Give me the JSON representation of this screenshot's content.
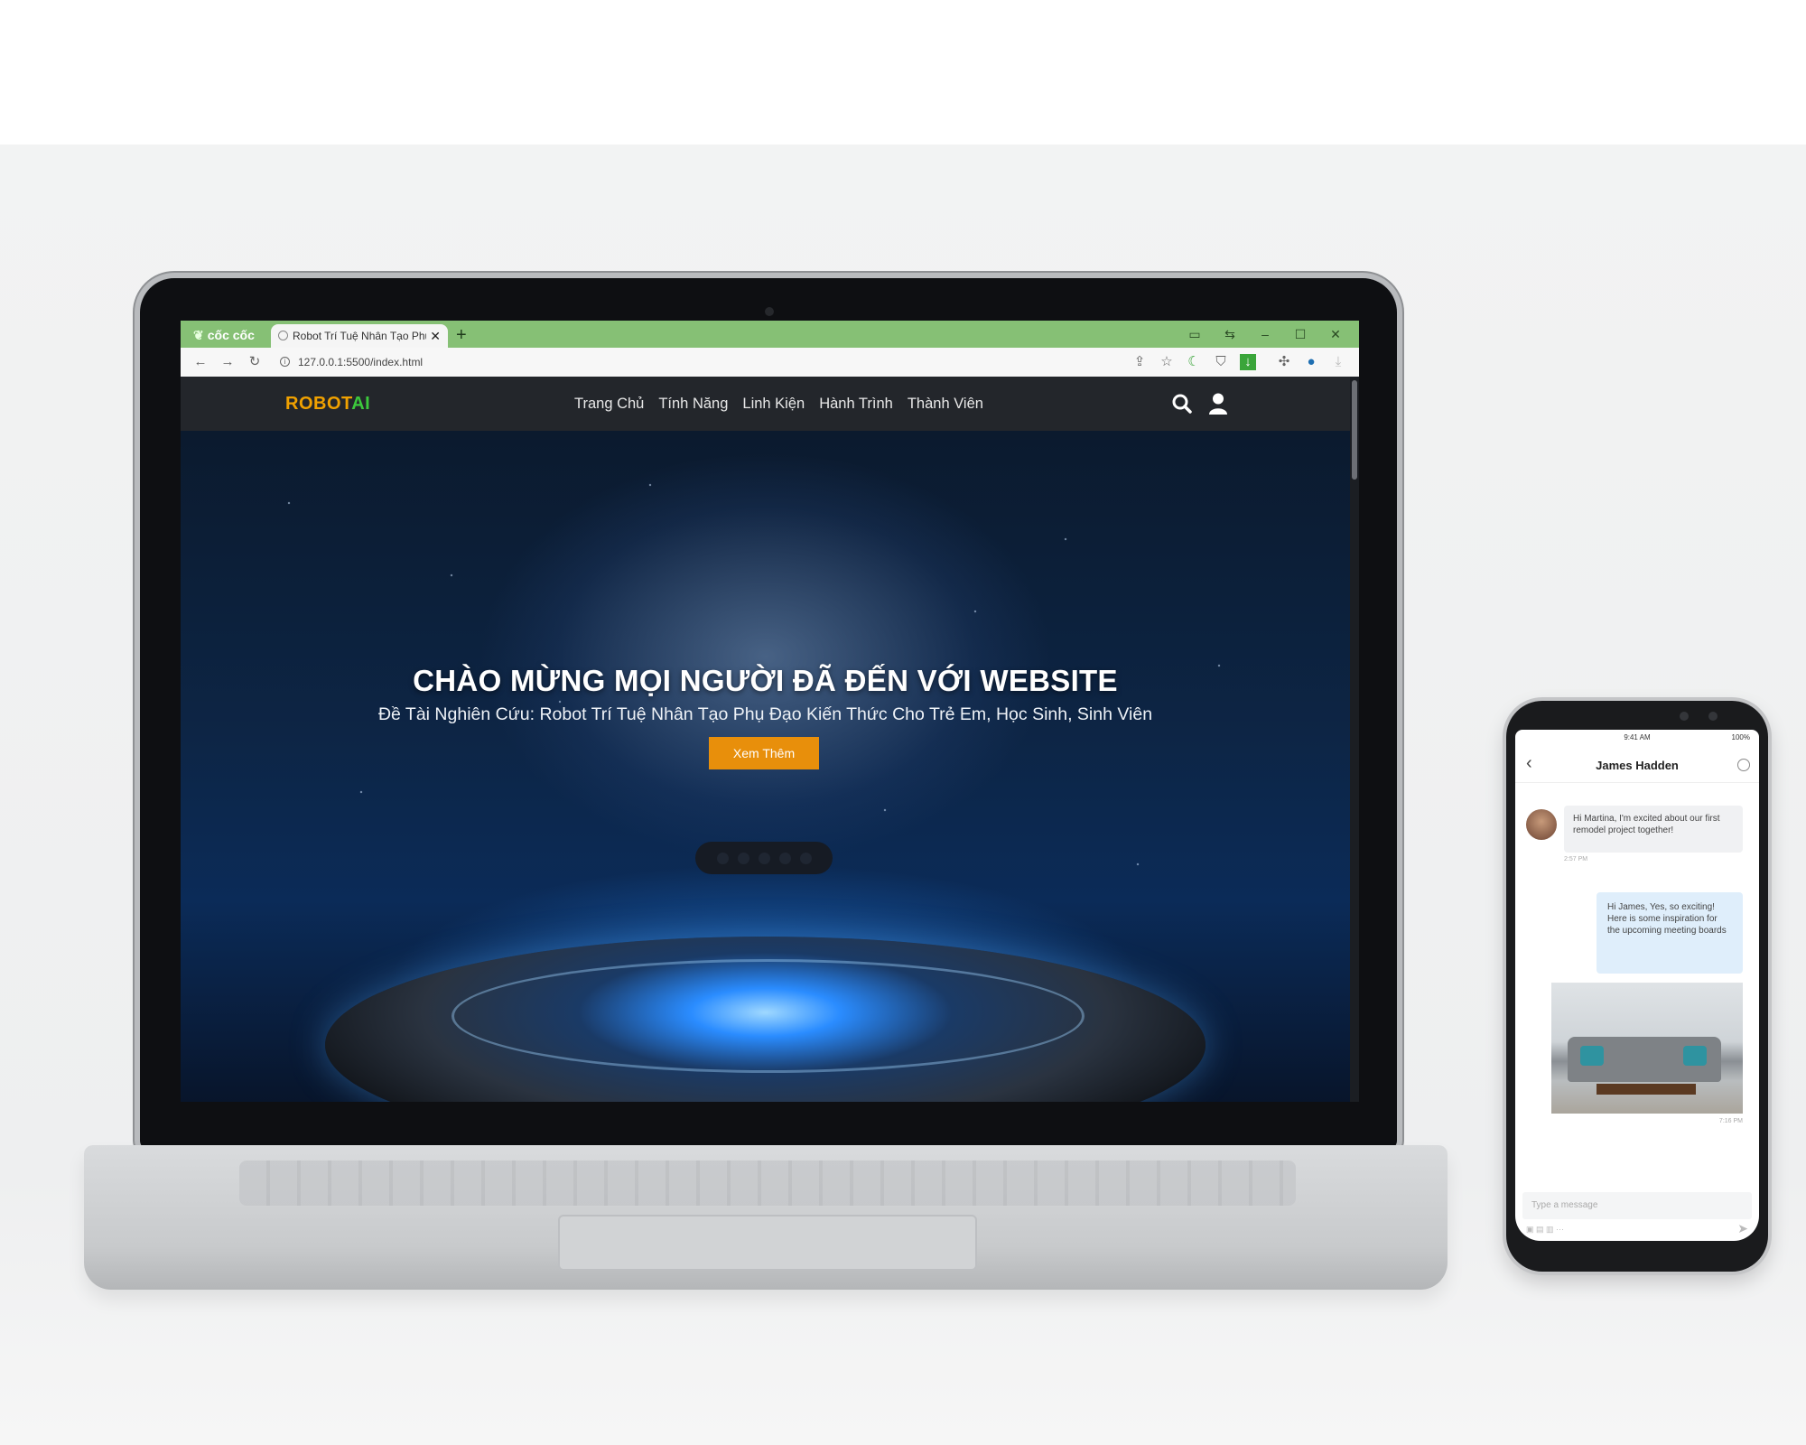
{
  "browser": {
    "brand": "cốc cốc",
    "tab_title": "Robot Trí Tuệ Nhân Tạo Phụ",
    "tab_close": "✕",
    "new_tab": "+",
    "url": "127.0.0.1:5500/index.html",
    "accent_color": "#86c075"
  },
  "site": {
    "logo_part1": "ROBOT",
    "logo_part2": "AI",
    "logo_colors": [
      "#f0a100",
      "#3cc93c"
    ],
    "nav": [
      "Trang Chủ",
      "Tính Năng",
      "Linh Kiện",
      "Hành Trình",
      "Thành Viên"
    ],
    "hero": {
      "title": "CHÀO MỪNG MỌI NGƯỜI ĐÃ ĐẾN VỚI WEBSITE",
      "subtitle": "Đề Tài Nghiên Cứu: Robot Trí Tuệ Nhân Tạo Phụ Đạo Kiến Thức Cho Trẻ Em, Học Sinh, Sinh Viên",
      "cta": "Xem Thêm",
      "cta_color": "#e88f0b",
      "slide_count": 5
    }
  },
  "phone": {
    "status_time": "9:41 AM",
    "status_battery": "100%",
    "contact_name": "James Hadden",
    "msg_in": "Hi Martina, I'm excited about our first remodel project together!",
    "msg_in_time": "2:57 PM",
    "msg_out": "Hi James, Yes, so exciting! Here is some inspiration for the upcoming meeting boards",
    "msg_out_time": "7:16 PM",
    "input_placeholder": "Type a message"
  }
}
